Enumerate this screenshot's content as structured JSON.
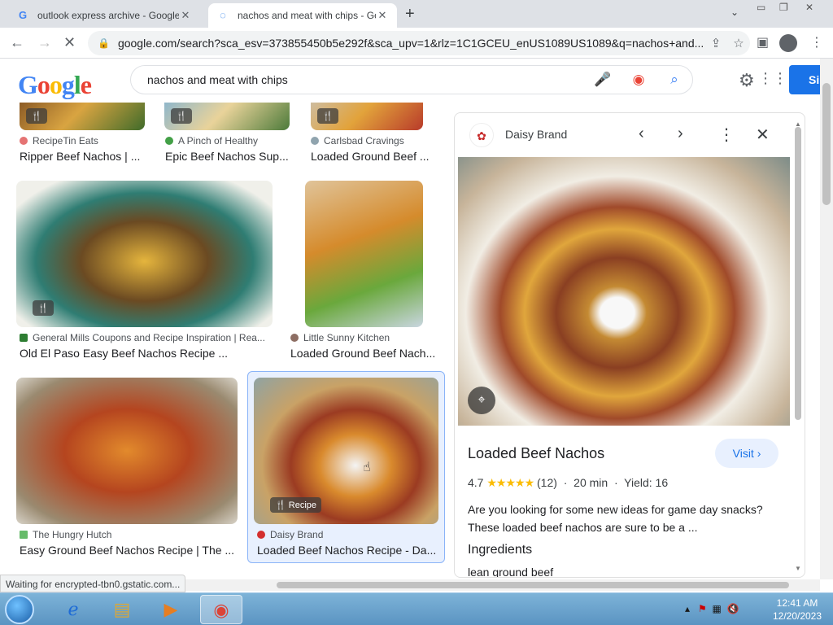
{
  "browser": {
    "tabs": [
      {
        "title": "outlook express archive - Google",
        "close": "✕"
      },
      {
        "title": "nachos and meat with chips - Go",
        "close": "✕"
      }
    ],
    "new_tab": "+",
    "url": "google.com/search?sca_esv=373855450b5e292f&sca_upv=1&rlz=1C1GCEU_enUS1089US1089&q=nachos+and...",
    "status": "Waiting for encrypted-tbn0.gstatic.com..."
  },
  "search": {
    "logo": "Google",
    "query": "nachos and meat with chips",
    "signin": "Si"
  },
  "results": [
    {
      "source": "RecipeTin Eats",
      "caption": "Ripper Beef Nachos | ..."
    },
    {
      "source": "A Pinch of Healthy",
      "caption": "Epic Beef Nachos Sup..."
    },
    {
      "source": "Carlsbad Cravings",
      "caption": "Loaded Ground Beef ..."
    },
    {
      "source": "General Mills Coupons and Recipe Inspiration | Rea...",
      "caption": "Old El Paso Easy Beef Nachos Recipe ..."
    },
    {
      "source": "Little Sunny Kitchen",
      "caption": "Loaded Ground Beef Nach..."
    },
    {
      "source": "The Hungry Hutch",
      "caption": "Easy Ground Beef Nachos Recipe | The ..."
    },
    {
      "source": "Daisy Brand",
      "caption": "Loaded Beef Nachos Recipe - Da...",
      "badge": "Recipe"
    }
  ],
  "panel": {
    "site": "Daisy Brand",
    "title": "Loaded Beef Nachos",
    "visit": "Visit ›",
    "rating": "4.7",
    "stars": "★★★★★",
    "reviews": "(12)",
    "time": "20 min",
    "yield": "Yield: 16",
    "description": "Are you looking for some new ideas for game day snacks? These loaded beef nachos are sure to be a ...",
    "ingredients_heading": "Ingredients",
    "ingredient_1": "lean ground beef"
  },
  "taskbar": {
    "time": "12:41 AM",
    "date": "12/20/2023"
  }
}
